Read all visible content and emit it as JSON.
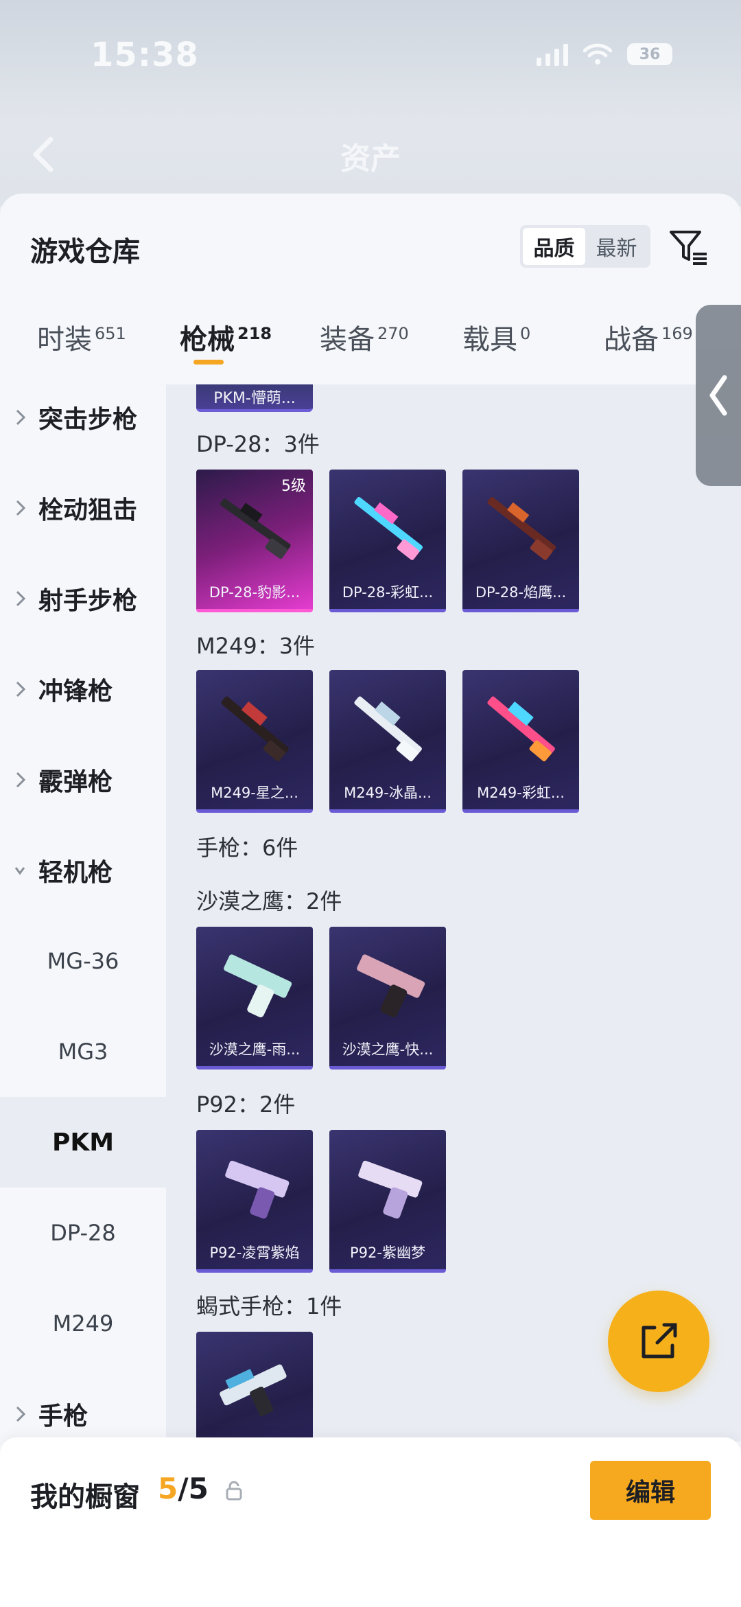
{
  "status": {
    "time": "15:38",
    "battery": "36"
  },
  "nav": {
    "title": "资产"
  },
  "header": {
    "title": "游戏仓库",
    "sort_options": [
      "品质",
      "最新"
    ]
  },
  "tabs": [
    {
      "label": "时装",
      "count": "651"
    },
    {
      "label": "枪械",
      "count": "218"
    },
    {
      "label": "装备",
      "count": "270"
    },
    {
      "label": "载具",
      "count": "0"
    },
    {
      "label": "战备",
      "count": "169"
    }
  ],
  "sidebar": {
    "categories": [
      "突击步枪",
      "栓动狙击",
      "射手步枪",
      "冲锋枪",
      "霰弹枪",
      "轻机枪"
    ],
    "subitems": [
      "MG-36",
      "MG3",
      "PKM",
      "DP-28",
      "M249"
    ],
    "last_category": "手枪"
  },
  "content": {
    "pkm_chip": "PKM-懵萌...",
    "groups": [
      {
        "title": "DP-28：3件",
        "items": [
          {
            "name": "DP-28-豹影...",
            "level": "5级"
          },
          {
            "name": "DP-28-彩虹..."
          },
          {
            "name": "DP-28-焰鹰..."
          }
        ]
      },
      {
        "title": "M249：3件",
        "items": [
          {
            "name": "M249-星之..."
          },
          {
            "name": "M249-冰晶..."
          },
          {
            "name": "M249-彩虹..."
          }
        ]
      },
      {
        "title": "手枪：6件"
      },
      {
        "title": "沙漠之鹰：2件",
        "items": [
          {
            "name": "沙漠之鹰-雨..."
          },
          {
            "name": "沙漠之鹰-快..."
          }
        ]
      },
      {
        "title": "P92：2件",
        "items": [
          {
            "name": "P92-凌霄紫焰"
          },
          {
            "name": "P92-紫幽梦"
          }
        ]
      },
      {
        "title": "蝎式手枪：1件"
      }
    ]
  },
  "showcase": {
    "title": "我的橱窗",
    "current": "5",
    "total": "/5",
    "edit_label": "编辑"
  },
  "colors": {
    "accent": "#f5a623",
    "card_purple": "#2d2760",
    "card_pink": "#e43ccf"
  }
}
